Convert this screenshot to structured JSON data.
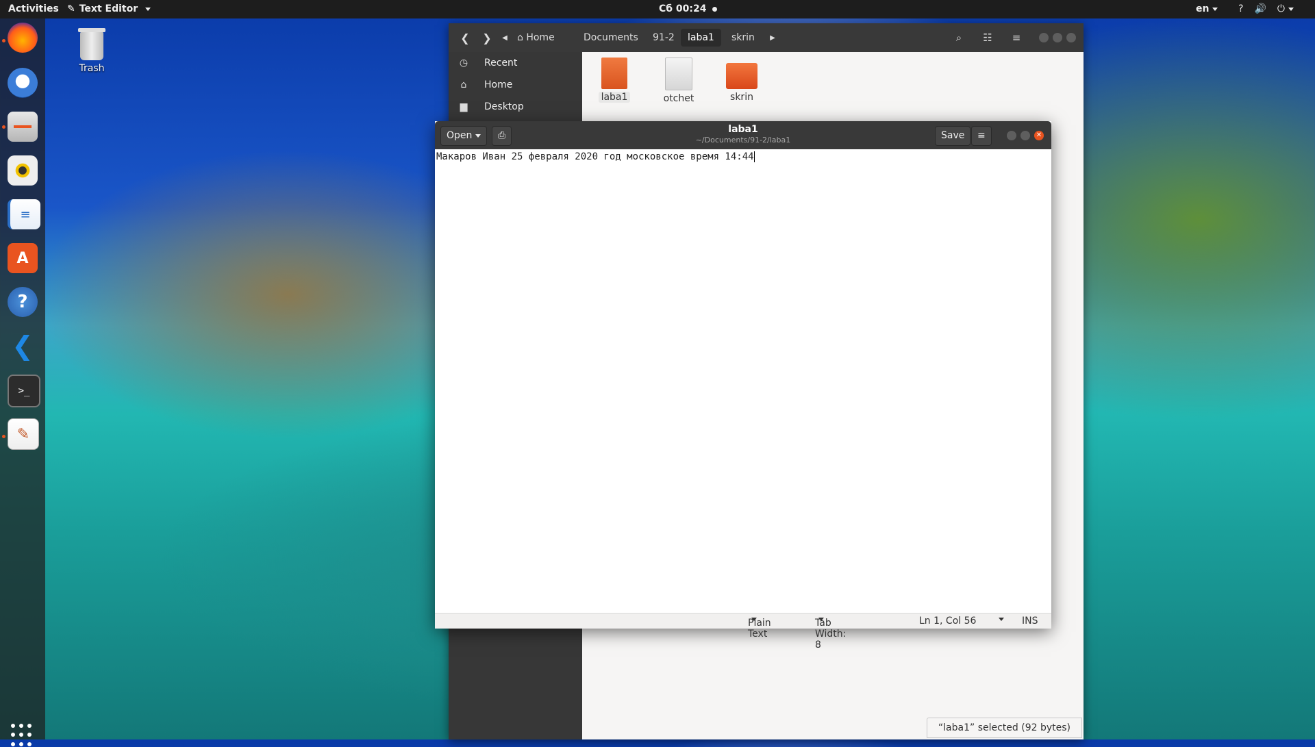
{
  "topbar": {
    "activities": "Activities",
    "app_menu": "Text Editor",
    "clock": "Сб 00:24",
    "language": "en"
  },
  "dock": {
    "items": [
      "firefox",
      "thunderbird",
      "files",
      "rhythmbox",
      "libreoffice-writer",
      "ubuntu-software",
      "help",
      "vscode",
      "terminal",
      "text-editor"
    ]
  },
  "desktop": {
    "trash_label": "Trash"
  },
  "file_manager": {
    "breadcrumbs": [
      "Home",
      "Documents",
      "91-2",
      "laba1",
      "skrin"
    ],
    "active_crumb": "laba1",
    "sidebar": [
      {
        "label": "Recent",
        "icon": "clock-icon"
      },
      {
        "label": "Home",
        "icon": "home-icon"
      },
      {
        "label": "Desktop",
        "icon": "folder-icon"
      }
    ],
    "files": [
      {
        "name": "laba1",
        "kind": "text-file",
        "color": "#e06530",
        "selected": true
      },
      {
        "name": "otchet",
        "kind": "document",
        "color": "#e2e2e2",
        "selected": false
      },
      {
        "name": "skrin",
        "kind": "folder",
        "color": "#e95420",
        "selected": false
      }
    ],
    "status": "“laba1” selected (92 bytes)"
  },
  "text_editor": {
    "open_label": "Open",
    "save_label": "Save",
    "title": "laba1",
    "path": "~/Documents/91-2/laba1",
    "content": "Макаров Иван 25 февраля 2020 год московское время 14:44",
    "status": {
      "language": "Plain Text",
      "tab_width": "Tab Width: 8",
      "position": "Ln 1, Col 56",
      "mode": "INS"
    }
  },
  "colors": {
    "accent": "#e95420",
    "close_button": "#e9531f",
    "header": "#393939"
  }
}
